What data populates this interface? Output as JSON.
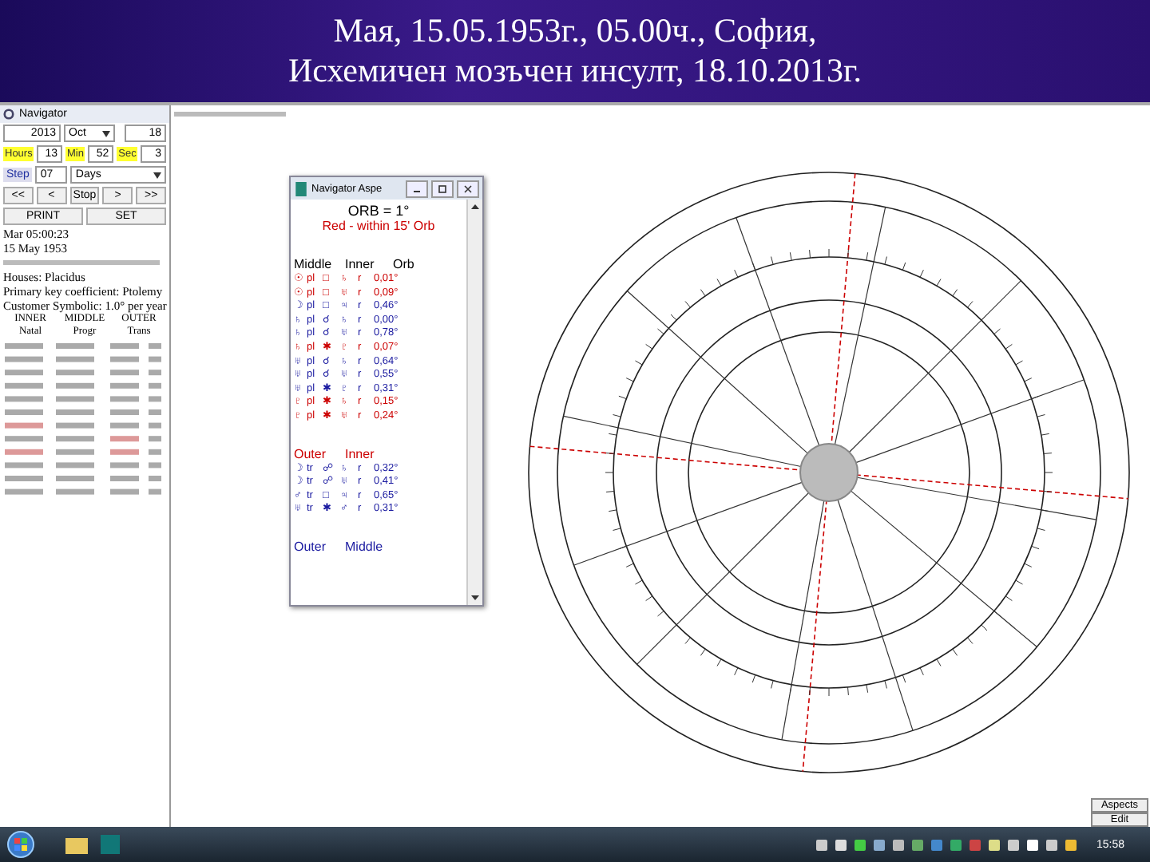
{
  "slide_title": {
    "lines": [
      "Мая, 15.05.1953г., 05.00ч., София,",
      "Исхемичен мозъчен инсулт, 18.10.2013г."
    ]
  },
  "navigator": {
    "title": "Navigator",
    "year": "2013",
    "month": "Oct",
    "day": "18",
    "time": [
      {
        "label": "Hours",
        "value": "13"
      },
      {
        "label": "Min",
        "value": "52"
      },
      {
        "label": "Sec",
        "value": "3"
      }
    ],
    "step_label": "Step",
    "step": "07",
    "step_unit": "Days",
    "nav_buttons": [
      "<<",
      "<",
      "Stop",
      ">",
      ">>"
    ],
    "actions": [
      "PRINT",
      "SET"
    ],
    "info": [
      "Mar 05:00:23",
      "15 May 1953"
    ],
    "info2": [
      "Houses: Placidus",
      "Primary key coefficient: Ptolemy",
      "Customer Symbolic: 1.0° per year"
    ],
    "columns": [
      {
        "title": "INNER",
        "sub": "Natal"
      },
      {
        "title": "MIDDLE",
        "sub": "Progr"
      },
      {
        "title": "OUTER",
        "sub": "Trans"
      }
    ]
  },
  "aspects_window": {
    "title": "Navigator Aspe",
    "orb": "ORB = 1°",
    "note": "Red - within 15' Orb",
    "sections": [
      {
        "color": "#000000",
        "heading": [
          "Middle",
          "Inner",
          "Orb"
        ],
        "rows": [
          {
            "color": "#cc0000",
            "cells": [
              "☉",
              "pl",
              "□",
              "♄",
              "r",
              "0,01°"
            ]
          },
          {
            "color": "#cc0000",
            "cells": [
              "☉",
              "pl",
              "□",
              "♅",
              "r",
              "0,09°"
            ]
          },
          {
            "color": "#1a1aa0",
            "cells": [
              "☽",
              "pl",
              "□",
              "♃",
              "r",
              "0,46°"
            ]
          },
          {
            "color": "#1a1aa0",
            "cells": [
              "♄",
              "pl",
              "☌",
              "♄",
              "r",
              "0,00°"
            ]
          },
          {
            "color": "#1a1aa0",
            "cells": [
              "♄",
              "pl",
              "☌",
              "♅",
              "r",
              "0,78°"
            ]
          },
          {
            "color": "#cc0000",
            "cells": [
              "♄",
              "pl",
              "✱",
              "♇",
              "r",
              "0,07°"
            ]
          },
          {
            "color": "#1a1aa0",
            "cells": [
              "♅",
              "pl",
              "☌",
              "♄",
              "r",
              "0,64°"
            ]
          },
          {
            "color": "#1a1aa0",
            "cells": [
              "♅",
              "pl",
              "☌",
              "♅",
              "r",
              "0,55°"
            ]
          },
          {
            "color": "#1a1aa0",
            "cells": [
              "♅",
              "pl",
              "✱",
              "♇",
              "r",
              "0,31°"
            ]
          },
          {
            "color": "#cc0000",
            "cells": [
              "♇",
              "pl",
              "✱",
              "♄",
              "r",
              "0,15°"
            ]
          },
          {
            "color": "#cc0000",
            "cells": [
              "♇",
              "pl",
              "✱",
              "♅",
              "r",
              "0,24°"
            ]
          }
        ]
      },
      {
        "color": "#cc0000",
        "heading": [
          "Outer",
          "Inner"
        ],
        "rows": [
          {
            "color": "#1a1aa0",
            "cells": [
              "☽",
              "tr",
              "☍",
              "♄",
              "r",
              "0,32°"
            ]
          },
          {
            "color": "#1a1aa0",
            "cells": [
              "☽",
              "tr",
              "☍",
              "♅",
              "r",
              "0,41°"
            ]
          },
          {
            "color": "#1a1aa0",
            "cells": [
              "♂",
              "tr",
              "□",
              "♃",
              "r",
              "0,65°"
            ]
          },
          {
            "color": "#1a1aa0",
            "cells": [
              "♅",
              "tr",
              "✱",
              "♂",
              "r",
              "0,31°"
            ]
          }
        ]
      },
      {
        "color": "#1a1aa0",
        "heading": [
          "Outer",
          "Middle"
        ]
      }
    ]
  },
  "side_buttons": [
    "Aspects",
    "Edit"
  ],
  "taskbar": {
    "clock": "15:58"
  }
}
